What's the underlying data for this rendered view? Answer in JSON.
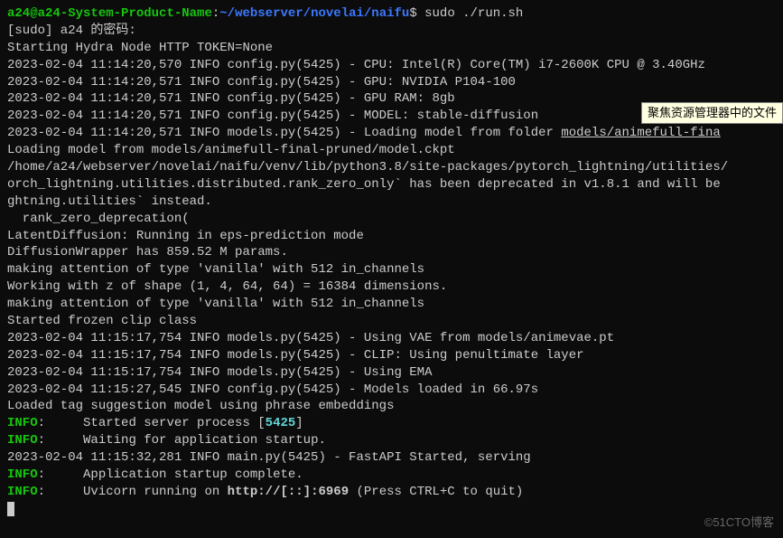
{
  "prompt": {
    "user": "a24",
    "at": "@",
    "host": "a24-System-Product-Name",
    "colon": ":",
    "path": "~/webserver/novelai/naifu",
    "dollar": "$",
    "command": " sudo ./run.sh"
  },
  "lines": {
    "l1": "[sudo] a24 的密码:",
    "l2": "Starting Hydra Node HTTP TOKEN=None",
    "l3": "2023-02-04 11:14:20,570 INFO config.py(5425) - CPU: Intel(R) Core(TM) i7-2600K CPU @ 3.40GHz",
    "l4": "2023-02-04 11:14:20,571 INFO config.py(5425) - GPU: NVIDIA P104-100",
    "l5": "2023-02-04 11:14:20,571 INFO config.py(5425) - GPU RAM: 8gb",
    "l6": "2023-02-04 11:14:20,571 INFO config.py(5425) - MODEL: stable-diffusion",
    "l7a": "2023-02-04 11:14:20,571 INFO models.py(5425) - Loading model from folder ",
    "l7b": "models/animefull-fina",
    "l8": "Loading model from models/animefull-final-pruned/model.ckpt",
    "l9": "/home/a24/webserver/novelai/naifu/venv/lib/python3.8/site-packages/pytorch_lightning/utilities/",
    "l10": "orch_lightning.utilities.distributed.rank_zero_only` has been deprecated in v1.8.1 and will be ",
    "l11": "ghtning.utilities` instead.",
    "l12": "  rank_zero_deprecation(",
    "l13": "LatentDiffusion: Running in eps-prediction mode",
    "l14": "DiffusionWrapper has 859.52 M params.",
    "l15": "making attention of type 'vanilla' with 512 in_channels",
    "l16": "Working with z of shape (1, 4, 64, 64) = 16384 dimensions.",
    "l17": "making attention of type 'vanilla' with 512 in_channels",
    "l18": "Started frozen clip class",
    "l19": "2023-02-04 11:15:17,754 INFO models.py(5425) - Using VAE from models/animevae.pt",
    "l20": "2023-02-04 11:15:17,754 INFO models.py(5425) - CLIP: Using penultimate layer",
    "l21": "2023-02-04 11:15:17,754 INFO models.py(5425) - Using EMA",
    "l22": "2023-02-04 11:15:27,545 INFO config.py(5425) - Models loaded in 66.97s",
    "l23": "Loaded tag suggestion model using phrase embeddings",
    "info": "INFO",
    "colon2": ":     ",
    "l24a": "Started server process [",
    "l24b": "5425",
    "l24c": "]",
    "l25": "Waiting for application startup.",
    "l26": "2023-02-04 11:15:32,281 INFO main.py(5425) - FastAPI Started, serving",
    "l27": "Application startup complete.",
    "l28a": "Uvicorn running on ",
    "l28b": "http://[::]:6969",
    "l28c": " (Press CTRL+C to quit)"
  },
  "tooltip": "聚焦资源管理器中的文件",
  "watermark": "©51CTO博客"
}
